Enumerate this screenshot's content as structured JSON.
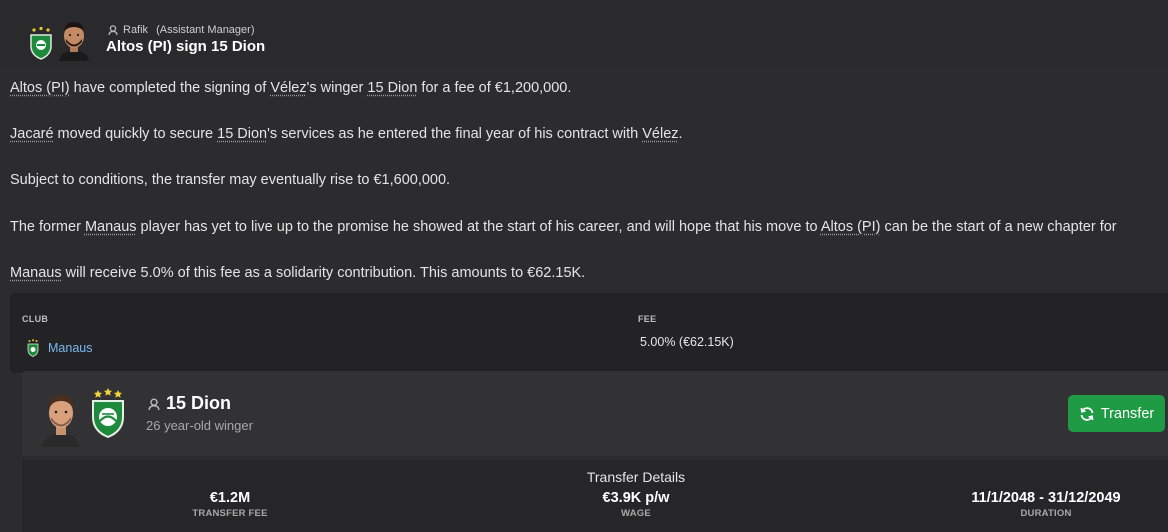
{
  "header": {
    "sender_name": "Rafik",
    "sender_role": "(Assistant Manager)",
    "title": "Altos (PI) sign 15 Dion"
  },
  "body": {
    "p1": {
      "club": "Altos (PI)",
      "t1": " have completed the signing of ",
      "selling_club": "Vélez",
      "t2": "'s winger ",
      "player": "15 Dion",
      "t3": " for a fee of €1,200,000."
    },
    "p2": {
      "manager": "Jacaré",
      "t1": " moved quickly to secure ",
      "player": "15 Dion",
      "t2": "'s services as he entered the final year of his contract with ",
      "club": "Vélez",
      "t3": "."
    },
    "p3": {
      "text": "Subject to conditions, the transfer may eventually rise to €1,600,000."
    },
    "p4": {
      "t1": "The former ",
      "club": "Manaus",
      "t2": " player has yet to live up to the promise he showed at the start of his career, and will hope that his move to ",
      "club2": "Altos (PI)",
      "t3": " can be the start of a new chapter for"
    },
    "p5": {
      "club": "Manaus",
      "t1": " will receive 5.0% of this fee as a solidarity contribution. This amounts to €62.15K."
    }
  },
  "solidarity": {
    "club_label": "CLUB",
    "fee_label": "FEE",
    "club": "Manaus",
    "fee": "5.00% (€62.15K)"
  },
  "player": {
    "name": "15 Dion",
    "description": "26 year-old winger",
    "transfer_button": "Transfer"
  },
  "details": {
    "title": "Transfer Details",
    "fee_value": "€1.2M",
    "fee_label": "TRANSFER FEE",
    "wage_value": "€3.9K p/w",
    "wage_label": "WAGE",
    "duration_value": "11/1/2048 - 31/12/2049",
    "duration_label": "DURATION"
  },
  "colors": {
    "background": "#2c2c2e",
    "link": "#7ab8f0",
    "button": "#1f9a45",
    "badge_green": "#1e8a3c"
  },
  "icons": {
    "sender": "person-icon",
    "club_crest": "club-crest-icon",
    "transfer": "cycle-arrows-icon"
  }
}
